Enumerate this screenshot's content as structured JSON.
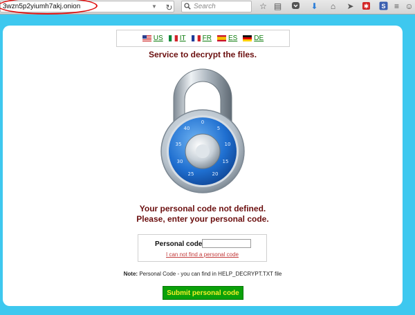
{
  "browser": {
    "url": "3wzn5p2yiumh7akj.onion",
    "search_placeholder": "Search"
  },
  "languages": [
    {
      "code": "US",
      "flag": "us"
    },
    {
      "code": "IT",
      "flag": "it"
    },
    {
      "code": "FR",
      "flag": "fr"
    },
    {
      "code": "ES",
      "flag": "es"
    },
    {
      "code": "DE",
      "flag": "de"
    }
  ],
  "page": {
    "title": "Service to decrypt the files.",
    "message_line1": "Your personal code not defined.",
    "message_line2": "Please, enter your personal code.",
    "code_label": "Personal code:",
    "code_value": "",
    "code_link": "I can not find a personal code",
    "note_label": "Note:",
    "note_text": " Personal Code - you can find in HELP_DECRYPT.TXT file",
    "submit_label": "Submit personal code"
  },
  "colors": {
    "background": "#3ec8ef",
    "title": "#6b0f0f",
    "link_green": "#0a7a0a",
    "button": "#0aa10a",
    "button_text": "#f6ee2a"
  }
}
